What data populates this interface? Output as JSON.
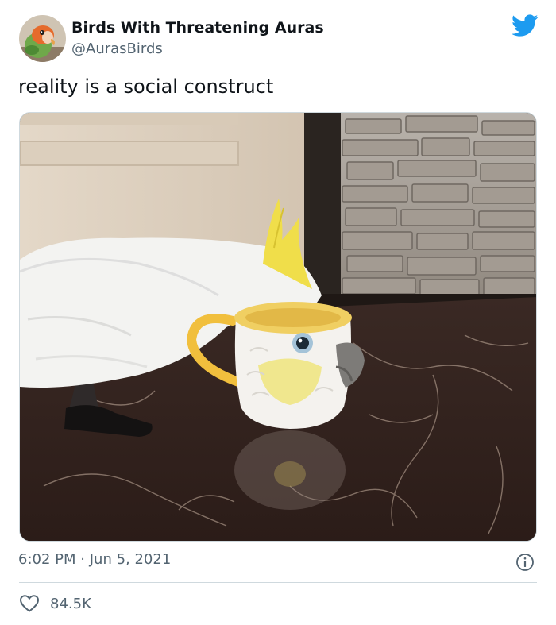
{
  "author": {
    "display_name": "Birds With Threatening Auras",
    "handle": "@AurasBirds",
    "avatar_icon": "parrot-avatar"
  },
  "brand": {
    "icon": "twitter-bird-icon",
    "color": "#1d9bf0"
  },
  "tweet": {
    "text": "reality is a social construct",
    "media_icon": "cockatoo-mug-photo"
  },
  "meta": {
    "time": "6:02 PM",
    "separator": "·",
    "date": "Jun 5, 2021",
    "info_icon": "info-icon"
  },
  "engagement": {
    "like_icon": "heart-icon",
    "likes": "84.5K"
  },
  "colors": {
    "text_primary": "#0f1419",
    "text_secondary": "#536471",
    "border": "#cfd9de"
  }
}
